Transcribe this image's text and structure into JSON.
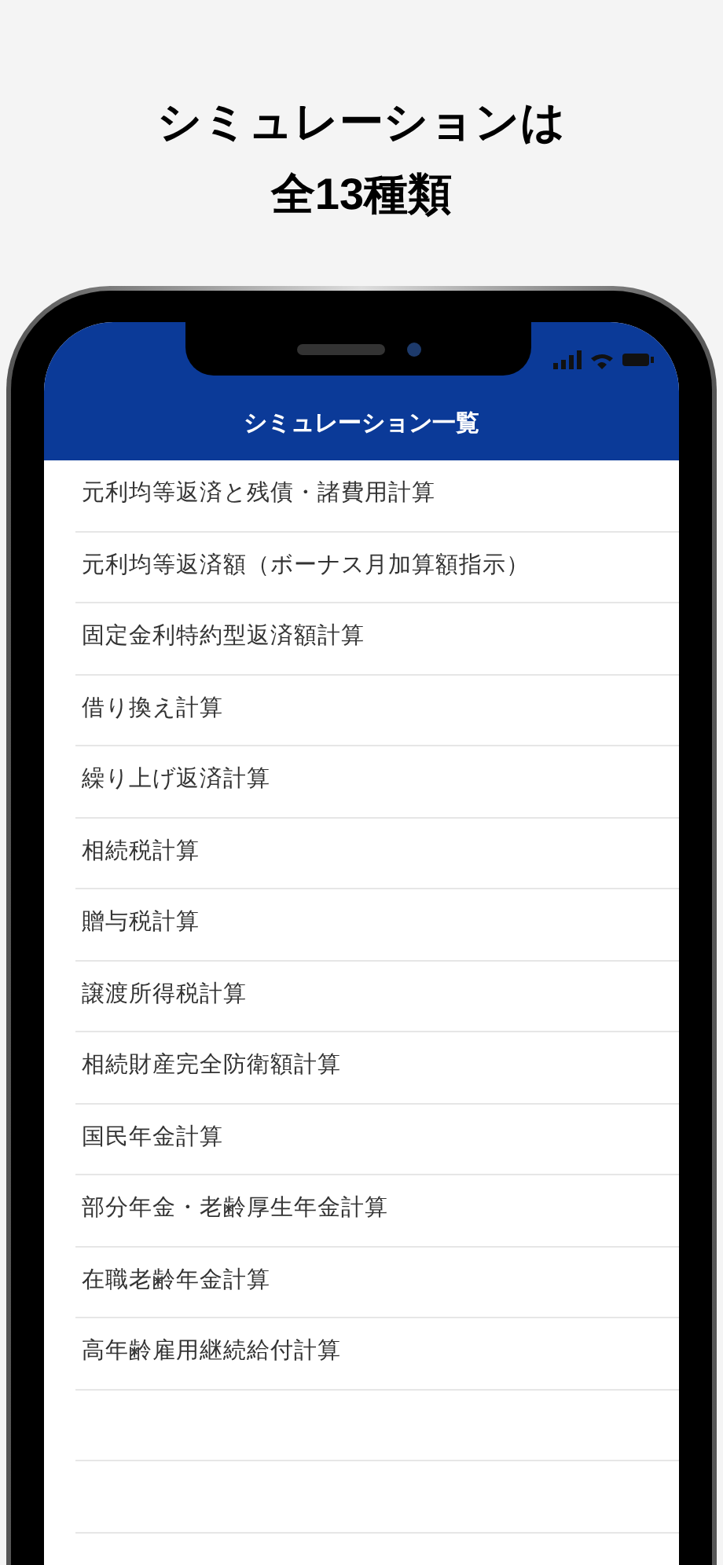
{
  "headline": [
    "シミュレーションは",
    "全13種類"
  ],
  "screen": {
    "title": "シミュレーション一覧",
    "items": [
      "元利均等返済と残債・諸費用計算",
      "元利均等返済額（ボーナス月加算額指示）",
      "固定金利特約型返済額計算",
      "借り換え計算",
      "繰り上げ返済計算",
      "相続税計算",
      "贈与税計算",
      "譲渡所得税計算",
      "相続財産完全防衛額計算",
      "国民年金計算",
      "部分年金・老齢厚生年金計算",
      "在職老齢年金計算",
      "高年齢雇用継続給付計算"
    ]
  }
}
